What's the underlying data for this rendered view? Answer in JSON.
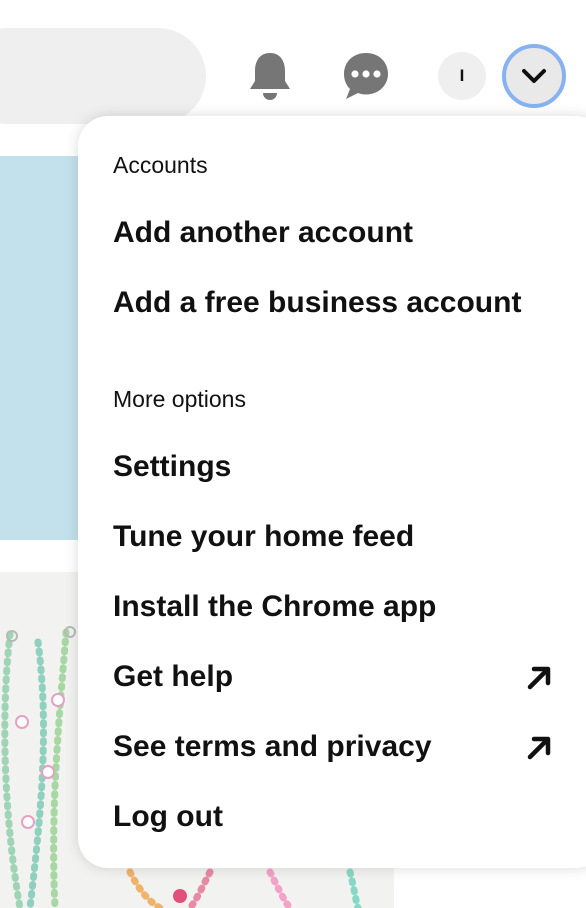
{
  "header": {
    "avatar_initial": "I",
    "icons": {
      "notifications": "bell-icon",
      "messages": "chat-bubble-icon",
      "account_menu": "chevron-down-icon"
    }
  },
  "menu": {
    "accounts_label": "Accounts",
    "accounts_items": [
      {
        "label": "Add another account"
      },
      {
        "label": "Add a free business account"
      }
    ],
    "more_options_label": "More options",
    "more_items": [
      {
        "label": "Settings"
      },
      {
        "label": "Tune your home feed"
      },
      {
        "label": "Install the Chrome app"
      },
      {
        "label": "Get help",
        "icon": "external-arrow-icon"
      },
      {
        "label": "See terms and privacy",
        "icon": "external-arrow-icon"
      },
      {
        "label": "Log out"
      }
    ]
  },
  "colors": {
    "focus_ring": "#86b3f0",
    "icon_gray": "#767676",
    "text": "#111111",
    "pin_blue": "#c3e1ec"
  }
}
